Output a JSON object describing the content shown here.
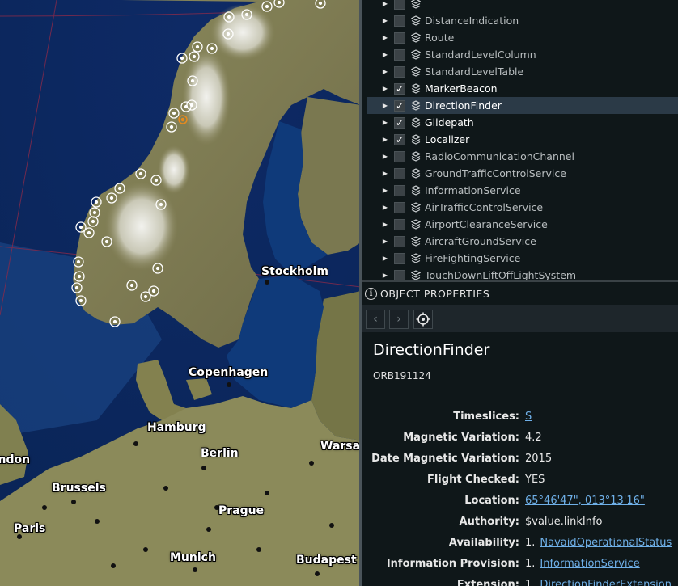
{
  "map": {
    "cities": [
      "Stockholm",
      "Copenhagen",
      "Hamburg",
      "Berlin",
      "Warsaw",
      "London",
      "Brussels",
      "Prague",
      "Paris",
      "Munich",
      "Budapest"
    ]
  },
  "layer_tree": {
    "items": [
      {
        "label": "",
        "checked": false
      },
      {
        "label": "DistanceIndication",
        "checked": false
      },
      {
        "label": "Route",
        "checked": false
      },
      {
        "label": "StandardLevelColumn",
        "checked": false
      },
      {
        "label": "StandardLevelTable",
        "checked": false
      },
      {
        "label": "MarkerBeacon",
        "checked": true
      },
      {
        "label": "DirectionFinder",
        "checked": true,
        "selected": true
      },
      {
        "label": "Glidepath",
        "checked": true
      },
      {
        "label": "Localizer",
        "checked": true
      },
      {
        "label": "RadioCommunicationChannel",
        "checked": false
      },
      {
        "label": "GroundTrafficControlService",
        "checked": false
      },
      {
        "label": "InformationService",
        "checked": false
      },
      {
        "label": "AirTrafficControlService",
        "checked": false
      },
      {
        "label": "AirportClearanceService",
        "checked": false
      },
      {
        "label": "AircraftGroundService",
        "checked": false
      },
      {
        "label": "FireFightingService",
        "checked": false
      },
      {
        "label": "TouchDownLiftOffLightSystem",
        "checked": false
      }
    ],
    "check_glyph": "✓"
  },
  "properties": {
    "header": "OBJECT PROPERTIES",
    "info_glyph": "i",
    "prev_glyph": "‹",
    "next_glyph": "›",
    "object_title": "DirectionFinder",
    "object_id": "ORB191124",
    "rows": [
      {
        "key": "Timeslices:",
        "value": "S",
        "link": true
      },
      {
        "key": "Magnetic Variation:",
        "value": "4.2",
        "link": false
      },
      {
        "key": "Date Magnetic Variation:",
        "value": "2015",
        "link": false
      },
      {
        "key": "Flight Checked:",
        "value": "YES",
        "link": false
      },
      {
        "key": "Location:",
        "value": "65°46'47\", 013°13'16\"",
        "link": true
      },
      {
        "key": "Authority:",
        "value": "$value.linkInfo",
        "link": false
      },
      {
        "key": "Availability:",
        "num": "1.",
        "value": "NavaidOperationalStatus",
        "link": true
      },
      {
        "key": "Information Provision:",
        "num": "1.",
        "value": "InformationService",
        "link": true
      },
      {
        "key": "Extension:",
        "num": "1.",
        "value": "DirectionFinderExtension",
        "link": true
      }
    ]
  }
}
